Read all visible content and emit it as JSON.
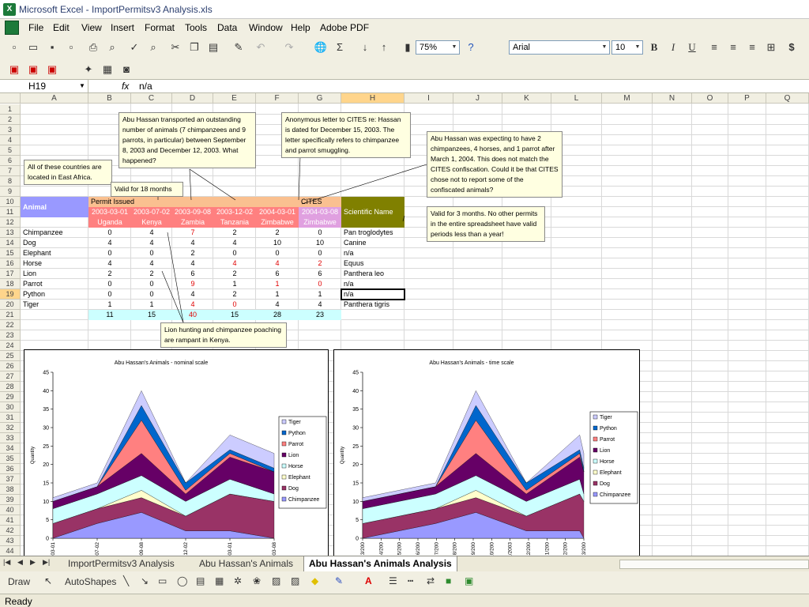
{
  "window": {
    "title": "Microsoft Excel - ImportPermitsv3 Analysis.xls"
  },
  "menu": [
    "File",
    "Edit",
    "View",
    "Insert",
    "Format",
    "Tools",
    "Data",
    "Window",
    "Help",
    "Adobe PDF"
  ],
  "toolbar": {
    "zoom": "75%",
    "font": "Arial",
    "font_size": "10",
    "bold": "B",
    "italic": "I",
    "underline": "U",
    "currency": "$",
    "sum": "Σ",
    "help_icon": "help-icon"
  },
  "formula_bar": {
    "name_box": "H19",
    "fx": "fx",
    "value": "n/a"
  },
  "columns": [
    "A",
    "B",
    "C",
    "D",
    "E",
    "F",
    "G",
    "H",
    "I",
    "J",
    "K",
    "L",
    "M",
    "N",
    "O",
    "P",
    "Q"
  ],
  "rows": [
    "1",
    "2",
    "3",
    "4",
    "5",
    "6",
    "7",
    "8",
    "9",
    "10",
    "11",
    "12",
    "13",
    "14",
    "15",
    "16",
    "17",
    "18",
    "19",
    "20",
    "21",
    "22",
    "23",
    "24",
    "25",
    "26",
    "27",
    "28",
    "29",
    "30",
    "31",
    "32",
    "33",
    "34",
    "35",
    "36",
    "37",
    "38",
    "39",
    "40",
    "41",
    "42",
    "43",
    "44"
  ],
  "sheet": {
    "header_animal": "Animal",
    "permit_issued": "Permit Issued",
    "cites": "CITES",
    "scientific_name": "Scientific Name",
    "permits": [
      {
        "date": "2003-03-01",
        "country": "Uganda"
      },
      {
        "date": "2003-07-02",
        "country": "Kenya"
      },
      {
        "date": "2003-09-08",
        "country": "Zambia"
      },
      {
        "date": "2003-12-02",
        "country": "Tanzania"
      },
      {
        "date": "2004-03-01",
        "country": "Zimbabwe"
      },
      {
        "date": "2004-03-08",
        "country": "Zimbabwe"
      }
    ],
    "animals": [
      {
        "name": "Chimpanzee",
        "vals": [
          "0",
          "4",
          "7",
          "2",
          "2",
          "0"
        ],
        "sci": "Pan troglodytes"
      },
      {
        "name": "Dog",
        "vals": [
          "4",
          "4",
          "4",
          "4",
          "10",
          "10"
        ],
        "sci": "Canine"
      },
      {
        "name": "Elephant",
        "vals": [
          "0",
          "0",
          "2",
          "0",
          "0",
          "0"
        ],
        "sci": "n/a"
      },
      {
        "name": "Horse",
        "vals": [
          "4",
          "4",
          "4",
          "4",
          "4",
          "2"
        ],
        "sci": "Equus"
      },
      {
        "name": "Lion",
        "vals": [
          "2",
          "2",
          "6",
          "2",
          "6",
          "6"
        ],
        "sci": "Panthera leo"
      },
      {
        "name": "Parrot",
        "vals": [
          "0",
          "0",
          "9",
          "1",
          "1",
          "0"
        ],
        "sci": "n/a"
      },
      {
        "name": "Python",
        "vals": [
          "0",
          "0",
          "4",
          "2",
          "1",
          "1"
        ],
        "sci": "n/a"
      },
      {
        "name": "Tiger",
        "vals": [
          "1",
          "1",
          "4",
          "0",
          "4",
          "4"
        ],
        "sci": "Panthera tigris"
      }
    ],
    "totals": [
      "11",
      "15",
      "40",
      "15",
      "28",
      "23"
    ],
    "red_flags": [
      "2-2",
      "5-3",
      "5-4",
      "5-5",
      "7-2",
      "7-4",
      "7-5",
      "9-2",
      "9-3"
    ]
  },
  "notes": {
    "east_africa": "All of these countries are located in East Africa.",
    "valid18": "Valid for 18 months",
    "hassan": "Abu Hassan transported an outstanding number of animals (7 chimpanzees and 9 parrots, in particular) between September 8, 2003 and December 12, 2003. What happened?",
    "anonymous": "Anonymous letter to CITES re: Hassan is dated for December 15, 2003. The letter specifically refers to chimpanzee and parrot smuggling.",
    "expecting": "Abu Hassan was expecting to have 2 chimpanzees, 4 horses, and 1 parrot after March 1, 2004. This does not match the CITES confiscation. Could it be that CITES chose not to report some of the confiscated animals?",
    "valid3": "Valid for 3 months. No other permits in the entire spreadsheet have valid periods less than a year!",
    "lion": "Lion hunting and chimpanzee poaching are rampant in Kenya."
  },
  "chart_data": [
    {
      "type": "area",
      "title": "Abu Hassan's Animals - nominal scale",
      "ylabel": "Quantity",
      "ylim": [
        0,
        45
      ],
      "yticks": [
        "0",
        "5",
        "10",
        "15",
        "20",
        "25",
        "30",
        "35",
        "40",
        "45"
      ],
      "categories": [
        "2003-03-01",
        "2003-07-02",
        "2003-09-08",
        "2003-12-02",
        "2004-03-01",
        "2004-03-08"
      ],
      "tick_labels": [
        "03-01",
        "07-02",
        "09-08",
        "12-02",
        "03-01",
        "03-08"
      ],
      "series": [
        {
          "name": "Chimpanzee",
          "color": "#9999ff",
          "values": [
            0,
            4,
            7,
            2,
            2,
            0
          ]
        },
        {
          "name": "Dog",
          "color": "#993366",
          "values": [
            4,
            4,
            4,
            4,
            10,
            10
          ]
        },
        {
          "name": "Elephant",
          "color": "#ffffcc",
          "values": [
            0,
            0,
            2,
            0,
            0,
            0
          ]
        },
        {
          "name": "Horse",
          "color": "#ccffff",
          "values": [
            4,
            4,
            4,
            4,
            4,
            2
          ]
        },
        {
          "name": "Lion",
          "color": "#660066",
          "values": [
            2,
            2,
            6,
            2,
            6,
            6
          ]
        },
        {
          "name": "Parrot",
          "color": "#ff8080",
          "values": [
            0,
            0,
            9,
            1,
            1,
            0
          ]
        },
        {
          "name": "Python",
          "color": "#0066cc",
          "values": [
            0,
            0,
            4,
            2,
            1,
            1
          ]
        },
        {
          "name": "Tiger",
          "color": "#ccccff",
          "values": [
            1,
            1,
            4,
            0,
            4,
            4
          ]
        }
      ],
      "legend_labels": [
        "Tiger",
        "Python",
        "Parrot",
        "Lion",
        "Horse",
        "Elephant",
        "Dog",
        "Chimpanzee"
      ],
      "legend_colors": [
        "#ccccff",
        "#0066cc",
        "#ff8080",
        "#660066",
        "#ccffff",
        "#ffffcc",
        "#993366",
        "#9999ff"
      ],
      "legend": "right"
    },
    {
      "type": "area",
      "title": "Abu Hassan's Animals - time scale",
      "ylabel": "Quantity",
      "ylim": [
        0,
        45
      ],
      "yticks": [
        "0",
        "5",
        "10",
        "15",
        "20",
        "25",
        "30",
        "35",
        "40",
        "45"
      ],
      "categories": [
        "2003-03-01",
        "2003-07-02",
        "2003-09-08",
        "2003-12-02",
        "2004-03-01",
        "2004-03-08"
      ],
      "time_scale": true,
      "tick_labels": [
        "3/200",
        "4/200",
        "5/200",
        "6/200",
        "7/200",
        "8/200",
        "9/200",
        "10/200",
        "11/2003",
        "12/200",
        "1/200",
        "2/200",
        "3/200"
      ],
      "series": [
        {
          "name": "Chimpanzee",
          "color": "#9999ff",
          "values": [
            0,
            4,
            7,
            2,
            2,
            0
          ]
        },
        {
          "name": "Dog",
          "color": "#993366",
          "values": [
            4,
            4,
            4,
            4,
            10,
            10
          ]
        },
        {
          "name": "Elephant",
          "color": "#ffffcc",
          "values": [
            0,
            0,
            2,
            0,
            0,
            0
          ]
        },
        {
          "name": "Horse",
          "color": "#ccffff",
          "values": [
            4,
            4,
            4,
            4,
            4,
            2
          ]
        },
        {
          "name": "Lion",
          "color": "#660066",
          "values": [
            2,
            2,
            6,
            2,
            6,
            6
          ]
        },
        {
          "name": "Parrot",
          "color": "#ff8080",
          "values": [
            0,
            0,
            9,
            1,
            1,
            0
          ]
        },
        {
          "name": "Python",
          "color": "#0066cc",
          "values": [
            0,
            0,
            4,
            2,
            1,
            1
          ]
        },
        {
          "name": "Tiger",
          "color": "#ccccff",
          "values": [
            1,
            1,
            4,
            0,
            4,
            4
          ]
        }
      ],
      "legend_labels": [
        "Tiger",
        "Python",
        "Parrot",
        "Lion",
        "Horse",
        "Elephant",
        "Dog",
        "Chimpanzee"
      ],
      "legend_colors": [
        "#ccccff",
        "#0066cc",
        "#ff8080",
        "#660066",
        "#ccffff",
        "#ffffcc",
        "#993366",
        "#9999ff"
      ],
      "legend": "right"
    }
  ],
  "tabs": [
    "ImportPermitsv3 Analysis",
    "Abu Hassan's Animals",
    "Abu Hassan's Animals Analysis"
  ],
  "drawbar": {
    "draw": "Draw",
    "autoshapes": "AutoShapes"
  },
  "status": "Ready"
}
